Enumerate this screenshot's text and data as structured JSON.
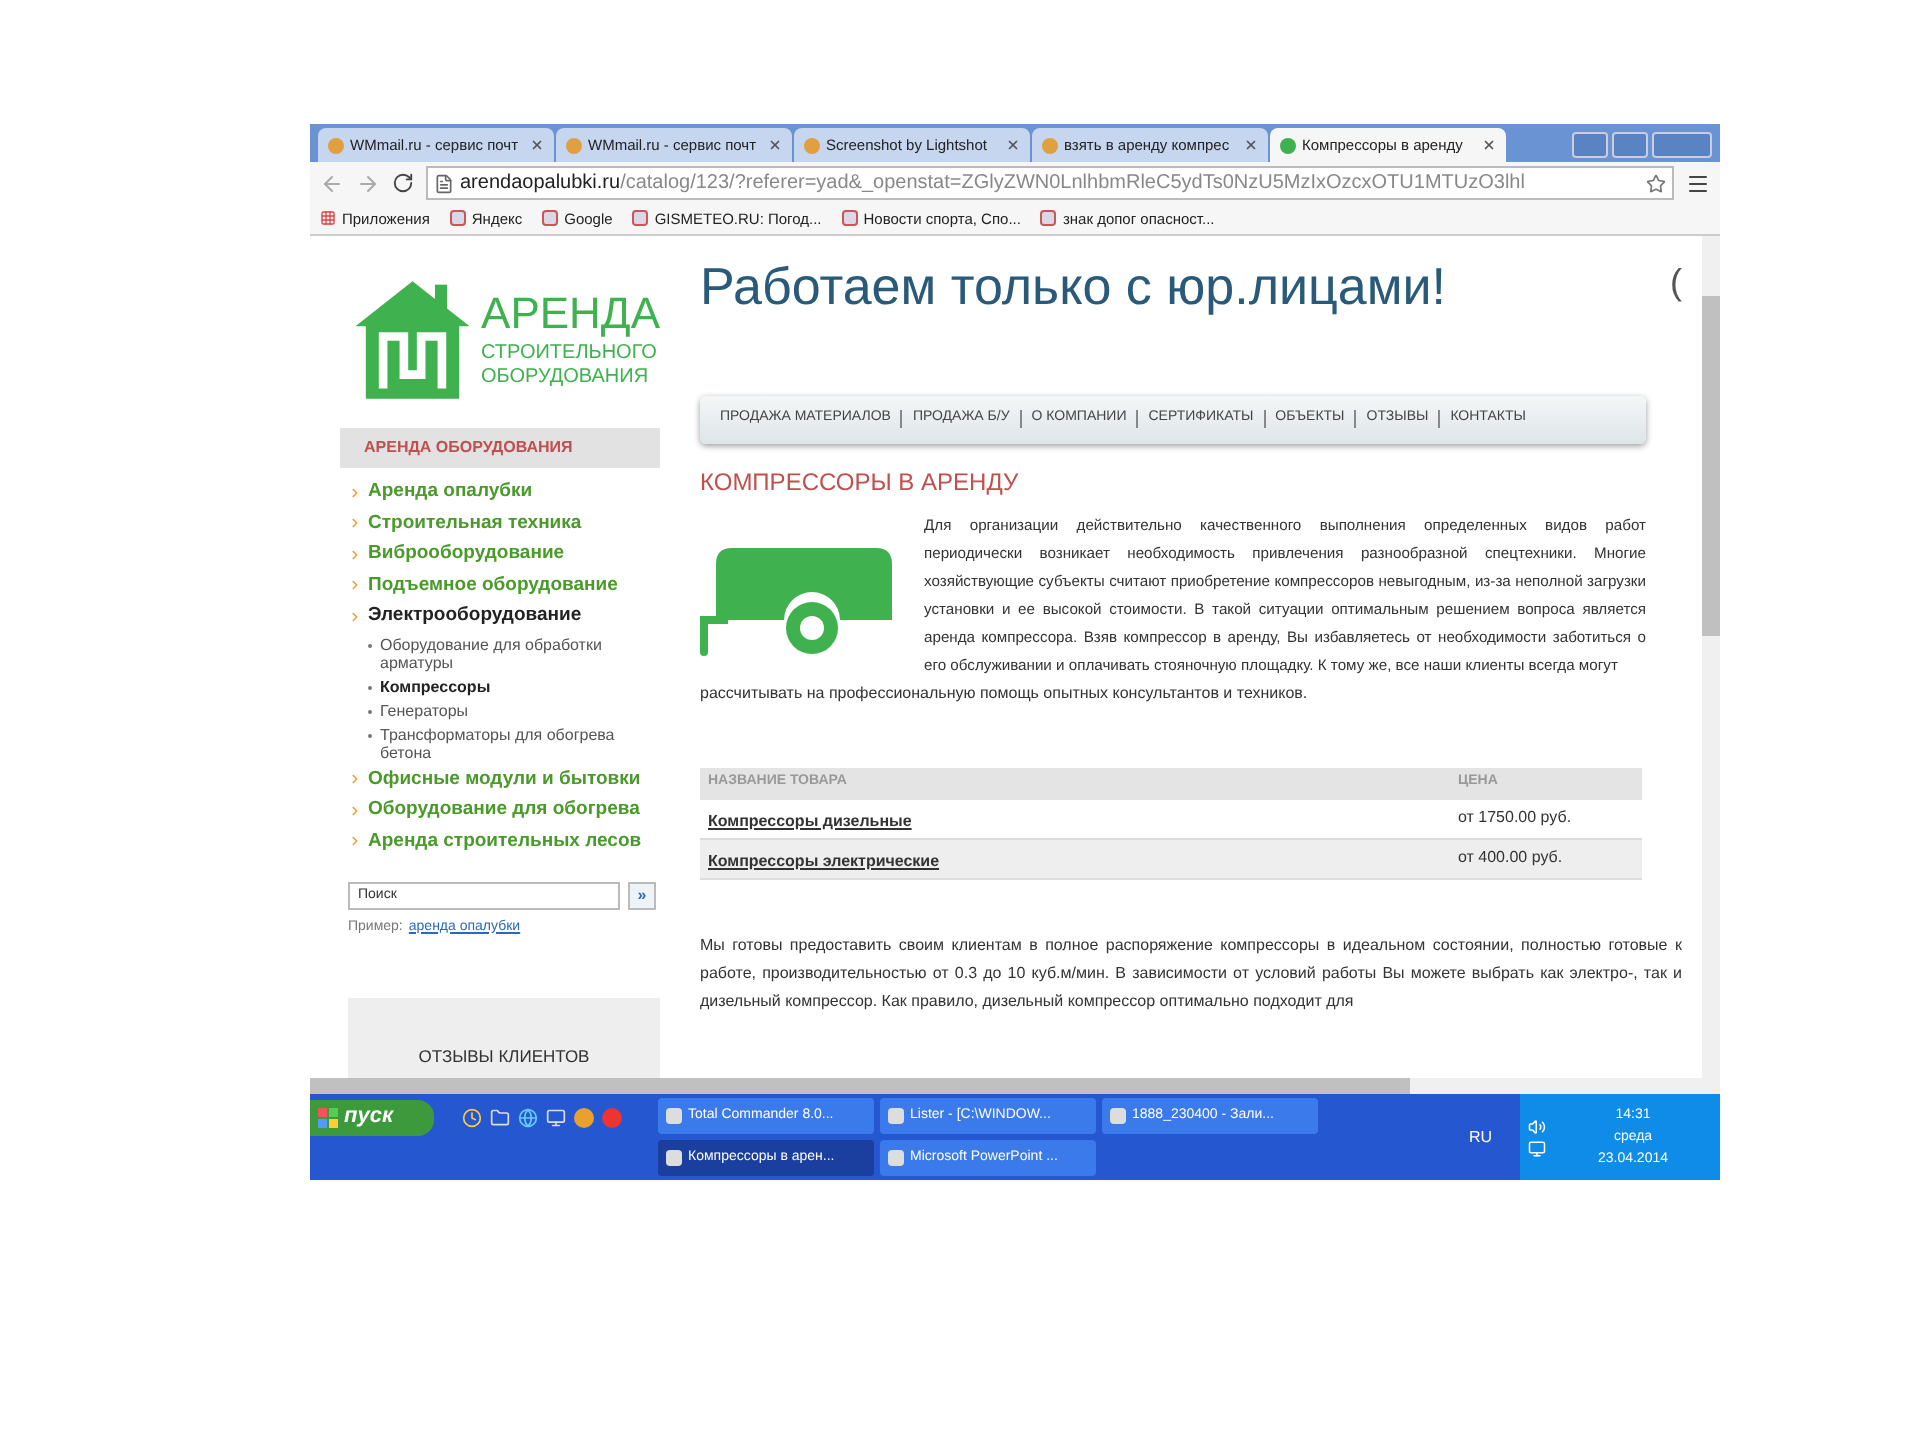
{
  "browser": {
    "tabs": [
      {
        "title": "WMmail.ru - сервис почт",
        "selected": false
      },
      {
        "title": "WMmail.ru - сервис почт",
        "selected": false
      },
      {
        "title": "Screenshot by Lightshot",
        "selected": false
      },
      {
        "title": "взять в аренду компрес",
        "selected": false
      },
      {
        "title": "Компрессоры в аренду",
        "selected": true
      }
    ],
    "url_host": "arendaopalubki.ru",
    "url_path": "/catalog/123/?referer=yad&_openstat=ZGlyZWN0LnlhbmRleC5ydTs0NzU5MzIxOzcxOTU1MTUzO3lhl",
    "bookmarks": [
      "Приложения",
      "Яндекс",
      "Google",
      "GISMETEO.RU: Погод...",
      "Новости спорта, Спо...",
      "знак допог опасност..."
    ]
  },
  "logo": {
    "line_1": "АРЕНДА",
    "line_2": "СТРОИТЕЛЬНОГО",
    "line_3": "ОБОРУДОВАНИЯ"
  },
  "sidebar": {
    "heading": "АРЕНДА ОБОРУДОВАНИЯ",
    "items": [
      {
        "label": "Аренда опалубки",
        "selected": false
      },
      {
        "label": "Строительная техника",
        "selected": false
      },
      {
        "label": "Виброоборудование",
        "selected": false
      },
      {
        "label": "Подъемное оборудование",
        "selected": false
      },
      {
        "label": "Электрооборудование",
        "selected": true,
        "children": [
          {
            "label": "Оборудование для обработки арматуры",
            "selected": false
          },
          {
            "label": "Компрессоры",
            "selected": true
          },
          {
            "label": "Генераторы",
            "selected": false
          },
          {
            "label": "Трансформаторы для обогрева бетона",
            "selected": false
          }
        ]
      },
      {
        "label": "Офисные модули и бытовки",
        "selected": false
      },
      {
        "label": "Оборудование для обогрева",
        "selected": false
      },
      {
        "label": "Аренда строительных лесов",
        "selected": false
      }
    ],
    "search": {
      "placeholder": "Поиск",
      "button": "»"
    },
    "example_label": "Пример:",
    "example_link": "аренда опалубки",
    "reviews_heading": "ОТЗЫВЫ КЛИЕНТОВ"
  },
  "main": {
    "headline": "Работаем только с юр.лицами!",
    "edge_text": "(",
    "nav": [
      "ПРОДАЖА МАТЕРИАЛОВ",
      "ПРОДАЖА Б/У",
      "О КОМПАНИИ",
      "СЕРТИФИКАТЫ",
      "ОБЪЕКТЫ",
      "ОТЗЫВЫ",
      "КОНТАКТЫ"
    ],
    "title": "КОМПРЕССОРЫ В АРЕНДУ",
    "intro": "Для организации действительно качественного выполнения определенных видов работ периодически возникает необходимость привлечения разнообразной спецтехники. Многие хозяйствующие субъекты считают приобретение компрессоров невыгодным, из-за неполной загрузки установки и ее высокой стоимости. В такой ситуации оптимальным решением вопроса является аренда компрессора. Взяв компрессор в аренду, Вы избавляетесь от необходимости заботиться о его обслуживании и оплачивать стояночную площадку. К тому же, все наши клиенты всегда могут",
    "intro_tail": "рассчитывать на профессиональную помощь опытных консультантов и техников.",
    "table": {
      "columns": [
        "НАЗВАНИЕ ТОВАРА",
        "ЦЕНА"
      ],
      "rows": [
        {
          "name": "Компрессоры дизельные",
          "price": "от 1750.00 руб."
        },
        {
          "name": "Компрессоры электрические",
          "price": "от 400.00 руб."
        }
      ]
    },
    "outro": "Мы готовы предоставить своим клиентам в полное распоряжение компрессоры в идеальном состоянии, полностью готовые к работе, производительностью от 0.3 до 10 куб.м/мин. В зависимости от условий работы Вы можете выбрать как электро-, так и дизельный компрессор. Как правило, дизельный компрессор оптимально подходит для"
  },
  "taskbar": {
    "start": "пуск",
    "windows": [
      {
        "title": "Total Commander 8.0...",
        "selected": false
      },
      {
        "title": "Lister - [C:\\WINDOW...",
        "selected": false
      },
      {
        "title": "1888_230400 - Зали...",
        "selected": false
      },
      {
        "title": "Компрессоры в арен...",
        "selected": true
      },
      {
        "title": "Microsoft PowerPoint ...",
        "selected": false
      }
    ],
    "language": "RU",
    "time": "14:31",
    "weekday": "среда",
    "date": "23.04.2014"
  }
}
